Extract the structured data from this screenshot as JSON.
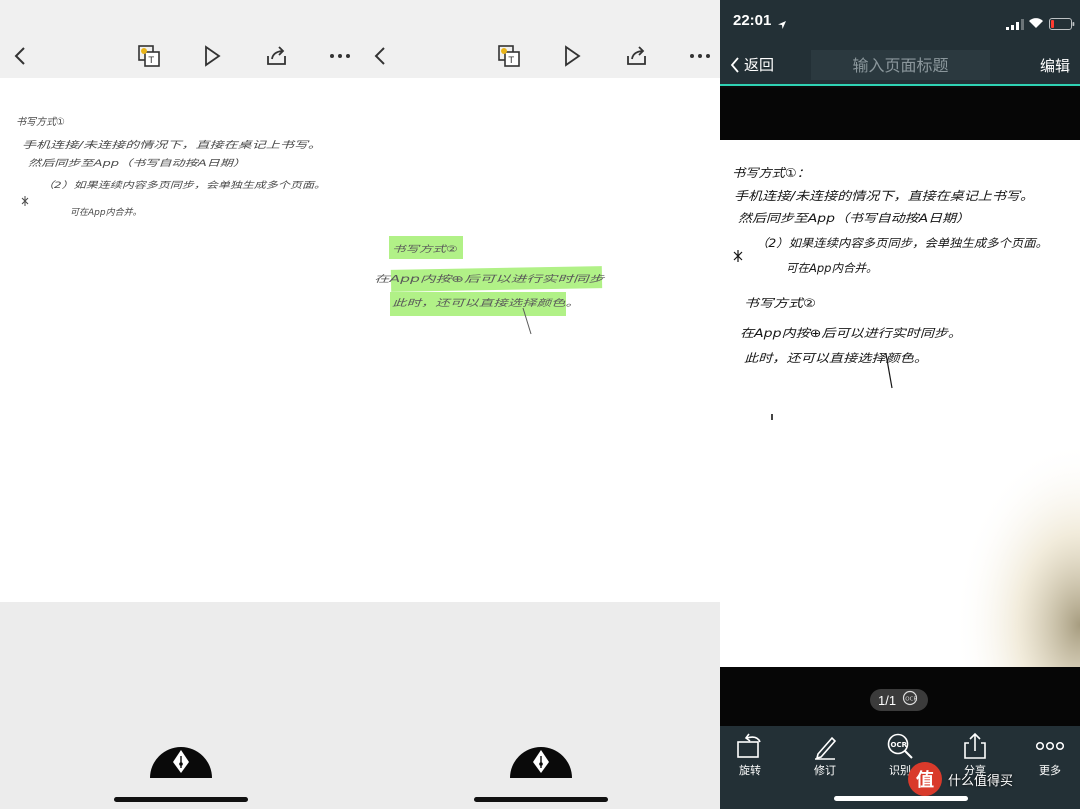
{
  "note_views": [
    {
      "handwriting": [
        "书写方式①",
        "手机连接/未连接的情况下，直接在桌记上书写。",
        "然后同步至App（书写自动按A日期）",
        "（2）如果连续内容多页同步，会单独生成多个页面。",
        "可在App内合并。"
      ]
    },
    {
      "handwriting": [
        "书写方式②",
        "在App内按⊕后可以进行实时同步",
        "此时，还可以直接选择颜色。"
      ]
    }
  ],
  "scan_view": {
    "status_time": "22:01",
    "back_label": "返回",
    "title_placeholder": "输入页面标题",
    "edit_label": "编辑",
    "page_count": "1/1",
    "handwriting": [
      "书写方式①：",
      "手机连接/未连接的情况下，直接在桌记上书写。",
      "然后同步至App（书写自动按A日期）",
      "（2）如果连续内容多页同步，会单独生成多个页面。",
      "可在App内合并。",
      "书写方式②",
      "在App内按⊕后可以进行实时同步。",
      "此时，还可以直接选择颜色。"
    ],
    "tabs": [
      {
        "label": "旋转",
        "icon": "rotate-icon"
      },
      {
        "label": "修订",
        "icon": "pen-edit-icon"
      },
      {
        "label": "识别",
        "icon": "ocr-icon"
      },
      {
        "label": "分享",
        "icon": "share-icon"
      },
      {
        "label": "更多",
        "icon": "more-icon"
      }
    ],
    "watermark": {
      "badge": "值",
      "text": "什么值得买"
    }
  },
  "colors": {
    "toolbar_bg": "#f0f0f0",
    "bottom_bg": "#ececec",
    "app_bar": "#233036",
    "accent_teal": "#2fd1b3",
    "highlight_green": "#a8f07a"
  }
}
